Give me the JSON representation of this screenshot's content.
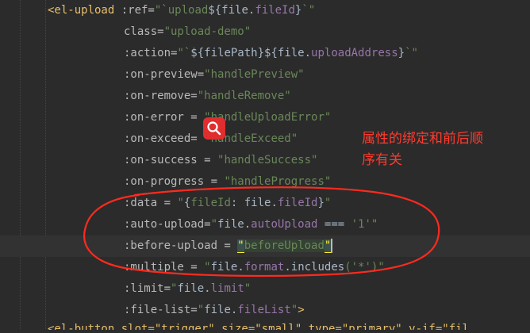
{
  "code_lines": [
    {
      "segments": [
        {
          "t": "<el-upload ",
          "c": "tag"
        },
        {
          "t": ":ref=",
          "c": "attr"
        },
        {
          "t": "\"`",
          "c": "str"
        },
        {
          "t": "upload",
          "c": "str"
        },
        {
          "t": "${",
          "c": "plain"
        },
        {
          "t": "file",
          "c": "plain"
        },
        {
          "t": ".",
          "c": "plain"
        },
        {
          "t": "fileId",
          "c": "prop"
        },
        {
          "t": "}",
          "c": "plain"
        },
        {
          "t": "`\"",
          "c": "str"
        }
      ]
    },
    {
      "segments": [
        {
          "t": "class=",
          "c": "attr"
        },
        {
          "t": "\"upload-demo\"",
          "c": "str"
        }
      ]
    },
    {
      "segments": [
        {
          "t": ":action=",
          "c": "attr"
        },
        {
          "t": "\"`",
          "c": "str"
        },
        {
          "t": "${",
          "c": "plain"
        },
        {
          "t": "filePath",
          "c": "plain"
        },
        {
          "t": "}${",
          "c": "plain"
        },
        {
          "t": "file",
          "c": "plain"
        },
        {
          "t": ".",
          "c": "plain"
        },
        {
          "t": "uploadAddress",
          "c": "prop"
        },
        {
          "t": "}",
          "c": "plain"
        },
        {
          "t": "`\"",
          "c": "str"
        }
      ]
    },
    {
      "segments": [
        {
          "t": ":on-preview=",
          "c": "attr"
        },
        {
          "t": "\"handlePreview\"",
          "c": "str"
        }
      ]
    },
    {
      "segments": [
        {
          "t": ":on-remove=",
          "c": "attr"
        },
        {
          "t": "\"handleRemove\"",
          "c": "str"
        }
      ]
    },
    {
      "segments": [
        {
          "t": ":on-error = ",
          "c": "attr"
        },
        {
          "t": "\"handleUploadError\"",
          "c": "str"
        }
      ]
    },
    {
      "segments": [
        {
          "t": ":on-exceed= ",
          "c": "attr"
        },
        {
          "t": "\"handleExceed\"",
          "c": "str"
        }
      ]
    },
    {
      "segments": [
        {
          "t": ":on-success = ",
          "c": "attr"
        },
        {
          "t": "\"handleSuccess\"",
          "c": "str"
        }
      ]
    },
    {
      "segments": [
        {
          "t": ":on-progress = ",
          "c": "attr"
        },
        {
          "t": "\"handleProgress\"",
          "c": "str"
        }
      ]
    },
    {
      "segments": [
        {
          "t": ":data = ",
          "c": "attr"
        },
        {
          "t": "\"",
          "c": "str"
        },
        {
          "t": "{",
          "c": "plain"
        },
        {
          "t": "fileId",
          "c": "str"
        },
        {
          "t": ": ",
          "c": "plain"
        },
        {
          "t": "file",
          "c": "plain"
        },
        {
          "t": ".",
          "c": "plain"
        },
        {
          "t": "fileId",
          "c": "prop"
        },
        {
          "t": "}",
          "c": "plain"
        },
        {
          "t": "\"",
          "c": "str"
        }
      ]
    },
    {
      "segments": [
        {
          "t": ":auto-upload=",
          "c": "attr"
        },
        {
          "t": "\"",
          "c": "str"
        },
        {
          "t": "file",
          "c": "plain"
        },
        {
          "t": ".",
          "c": "plain"
        },
        {
          "t": "autoUpload",
          "c": "prop"
        },
        {
          "t": " === ",
          "c": "plain"
        },
        {
          "t": "'1'",
          "c": "str"
        },
        {
          "t": "\"",
          "c": "str"
        }
      ]
    },
    {
      "segments": [
        {
          "t": ":before-upload = ",
          "c": "attr"
        },
        {
          "t": "\"",
          "c": "bracket-hl"
        },
        {
          "t": "beforeUpload",
          "c": "bracket-hl-text str"
        },
        {
          "t": "\"",
          "c": "bracket-hl"
        }
      ],
      "cursor": true
    },
    {
      "segments": [
        {
          "t": ":multiple = ",
          "c": "attr"
        },
        {
          "t": "\"",
          "c": "str"
        },
        {
          "t": "file",
          "c": "plain"
        },
        {
          "t": ".",
          "c": "plain"
        },
        {
          "t": "format",
          "c": "prop"
        },
        {
          "t": ".",
          "c": "plain"
        },
        {
          "t": "includes",
          "c": "plain"
        },
        {
          "t": "('*')",
          "c": "str"
        },
        {
          "t": "\"",
          "c": "str"
        }
      ]
    },
    {
      "segments": [
        {
          "t": ":limit=",
          "c": "attr"
        },
        {
          "t": "\"",
          "c": "str"
        },
        {
          "t": "file",
          "c": "plain"
        },
        {
          "t": ".",
          "c": "plain"
        },
        {
          "t": "limit",
          "c": "prop"
        },
        {
          "t": "\"",
          "c": "str"
        }
      ]
    },
    {
      "segments": [
        {
          "t": ":file-list=",
          "c": "attr"
        },
        {
          "t": "\"",
          "c": "str"
        },
        {
          "t": "file",
          "c": "plain"
        },
        {
          "t": ".",
          "c": "plain"
        },
        {
          "t": "fileList",
          "c": "prop"
        },
        {
          "t": "\"",
          "c": "str"
        },
        {
          "t": ">",
          "c": "tag"
        }
      ]
    }
  ],
  "annotation": {
    "line1": "属性的绑定和前后顺",
    "line2": "序有关"
  },
  "icons": {
    "search": "search-icon"
  },
  "colors": {
    "annotation": "#ff3b2f",
    "circle": "#ff2a1f",
    "background": "#2b2b2b"
  }
}
